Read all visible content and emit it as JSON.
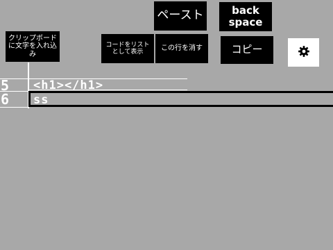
{
  "toolbar": {
    "import_label": "クリップボード\nに文字を入れ込み",
    "list_label": "コードをリスト\nとして表示",
    "delete_label": "この行を消す",
    "paste_label": "ペースト",
    "backspace_label": "back\nspace",
    "copy_label": "コピー",
    "settings_icon": "gear-icon"
  },
  "editor": {
    "lines": [
      {
        "number": "5",
        "text": "<h1></h1>"
      },
      {
        "number": "6",
        "text": "ss"
      }
    ],
    "active_line": "6"
  }
}
